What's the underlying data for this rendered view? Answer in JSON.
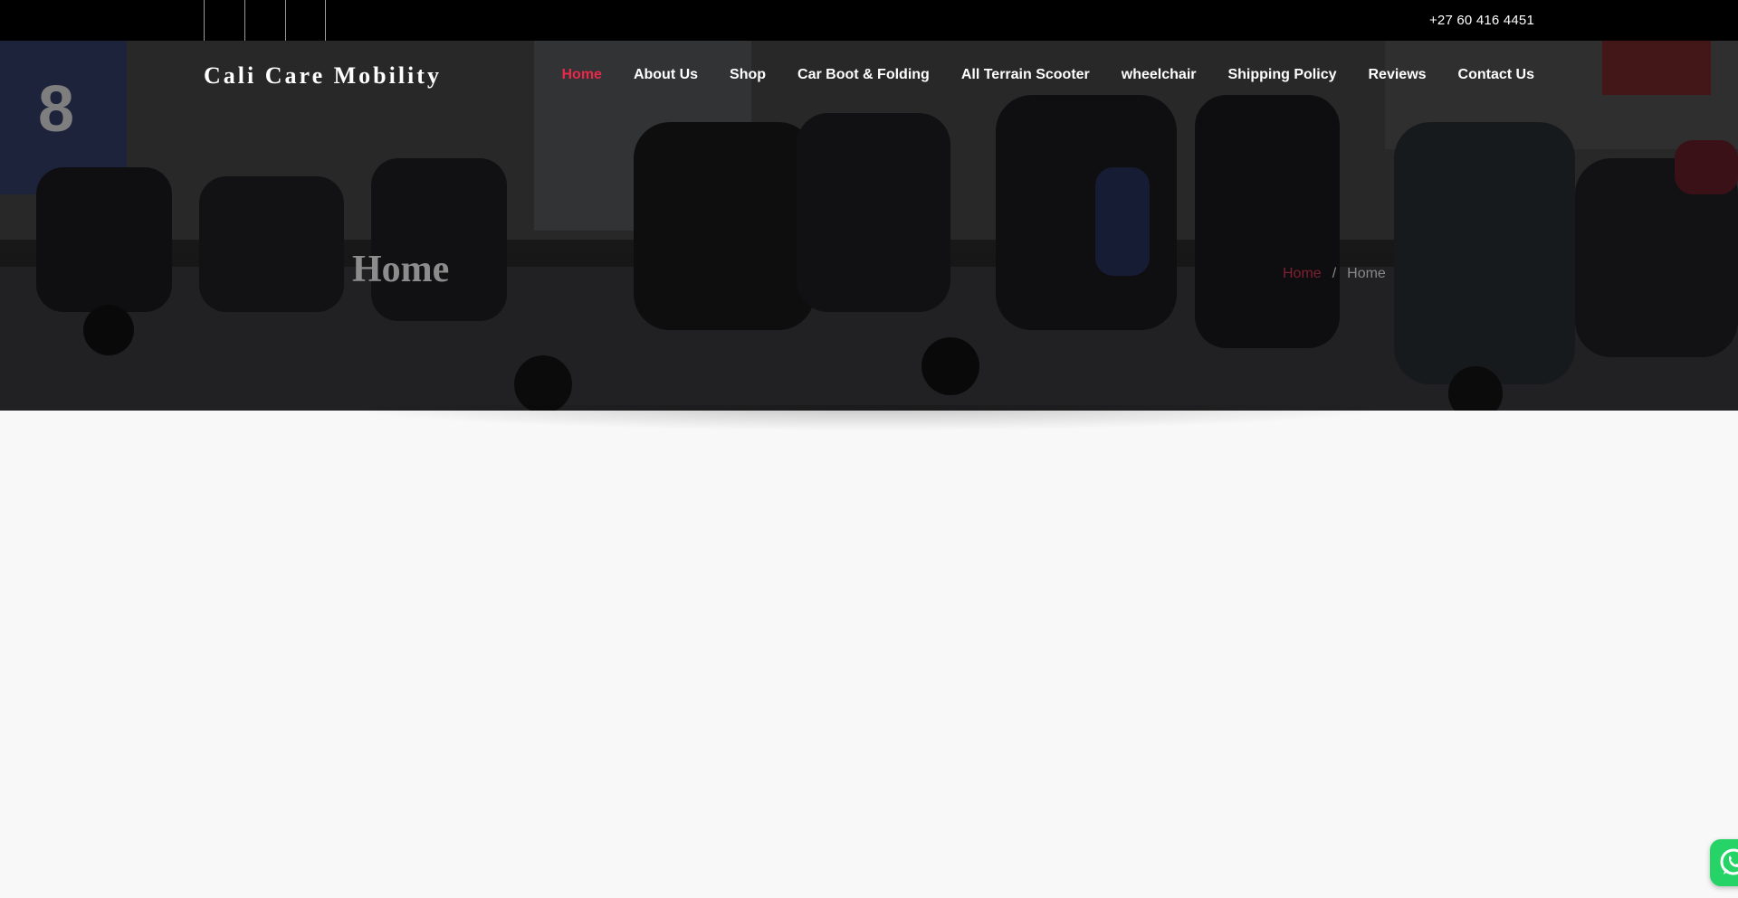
{
  "top_bar": {
    "phone": "+27 60 416 4451",
    "social_icons": [
      "social-link-1-icon",
      "social-link-2-icon",
      "social-link-3-icon"
    ]
  },
  "header": {
    "brand": "Cali Care Mobility",
    "nav": [
      {
        "label": "Home",
        "active": true
      },
      {
        "label": "About Us"
      },
      {
        "label": "Shop"
      },
      {
        "label": "Car Boot & Folding"
      },
      {
        "label": "All Terrain Scooter"
      },
      {
        "label": "wheelchair"
      },
      {
        "label": "Shipping Policy"
      },
      {
        "label": "Reviews"
      },
      {
        "label": "Contact Us"
      }
    ]
  },
  "hero": {
    "title": "Home",
    "breadcrumb": {
      "link": "Home",
      "separator": "/",
      "current": "Home"
    },
    "background": "mobility-scooter-showroom-photo"
  },
  "colors": {
    "accent": "#e8294c",
    "topbar": "#000000",
    "page_bg": "#f8f8f8",
    "whatsapp": "#25d366"
  },
  "floating": {
    "whatsapp_icon": "whatsapp-icon"
  }
}
